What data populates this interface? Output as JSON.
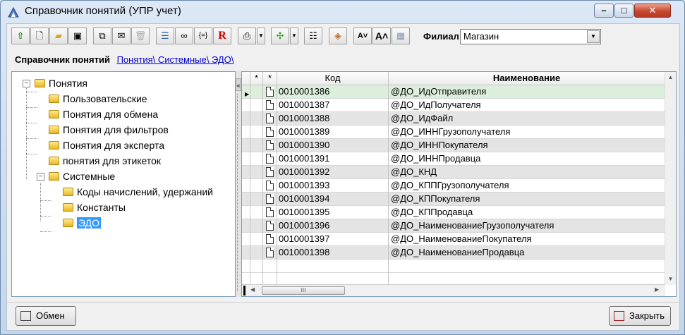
{
  "window": {
    "title": "Справочник понятий (УПР учет)",
    "controls": {
      "minimize": "–",
      "maximize": "□",
      "close": "✕"
    }
  },
  "toolbar": {
    "buttons": [
      "up-arrow-icon",
      "new-doc-icon",
      "folder-icon",
      "save-icon",
      "copy-icon",
      "envelope-icon",
      "delete-icon",
      "list-icon",
      "binoculars-icon",
      "brackets-icon",
      "r-icon",
      "printer-icon",
      "puzzle-icon",
      "columns-icon",
      "paint-icon",
      "font-smaller-icon",
      "font-larger-icon",
      "grid-icon"
    ],
    "filial_label": "Филиал",
    "filial_value": "Магазин"
  },
  "breadcrumb": {
    "title": "Справочник понятий",
    "path": "Понятия\\ Системные\\ ЭДО\\"
  },
  "tree": {
    "root": "Понятия",
    "items": [
      "Пользовательские",
      "Понятия для обмена",
      "Понятия для фильтров",
      "Понятия для эксперта",
      "понятия для этикеток",
      "Системные"
    ],
    "system_children": [
      "Коды начислений, удержаний",
      "Константы",
      "ЭДО"
    ]
  },
  "grid": {
    "columns": {
      "star1": "*",
      "star2": "*",
      "code": "Код",
      "name": "Наименование"
    },
    "rows": [
      {
        "code": "0010001386",
        "name": "@ДО_ИдОтправителя"
      },
      {
        "code": "0010001387",
        "name": "@ДО_ИдПолучателя"
      },
      {
        "code": "0010001388",
        "name": "@ДО_ИдФайл"
      },
      {
        "code": "0010001389",
        "name": "@ДО_ИННГрузополучателя"
      },
      {
        "code": "0010001390",
        "name": "@ДО_ИННПокупателя"
      },
      {
        "code": "0010001391",
        "name": "@ДО_ИННПродавца"
      },
      {
        "code": "0010001392",
        "name": "@ДО_КНД"
      },
      {
        "code": "0010001393",
        "name": "@ДО_КППГрузополучателя"
      },
      {
        "code": "0010001394",
        "name": "@ДО_КППокупателя"
      },
      {
        "code": "0010001395",
        "name": "@ДО_КППродавца"
      },
      {
        "code": "0010001396",
        "name": "@ДО_НаименованиеГрузополучателя"
      },
      {
        "code": "0010001397",
        "name": "@ДО_НаименованиеПокупателя"
      },
      {
        "code": "0010001398",
        "name": "@ДО_НаименованиеПродавца"
      }
    ],
    "hscroll_grip": "III"
  },
  "footer": {
    "exchange_label": "Обмен",
    "close_label": "Закрыть"
  }
}
